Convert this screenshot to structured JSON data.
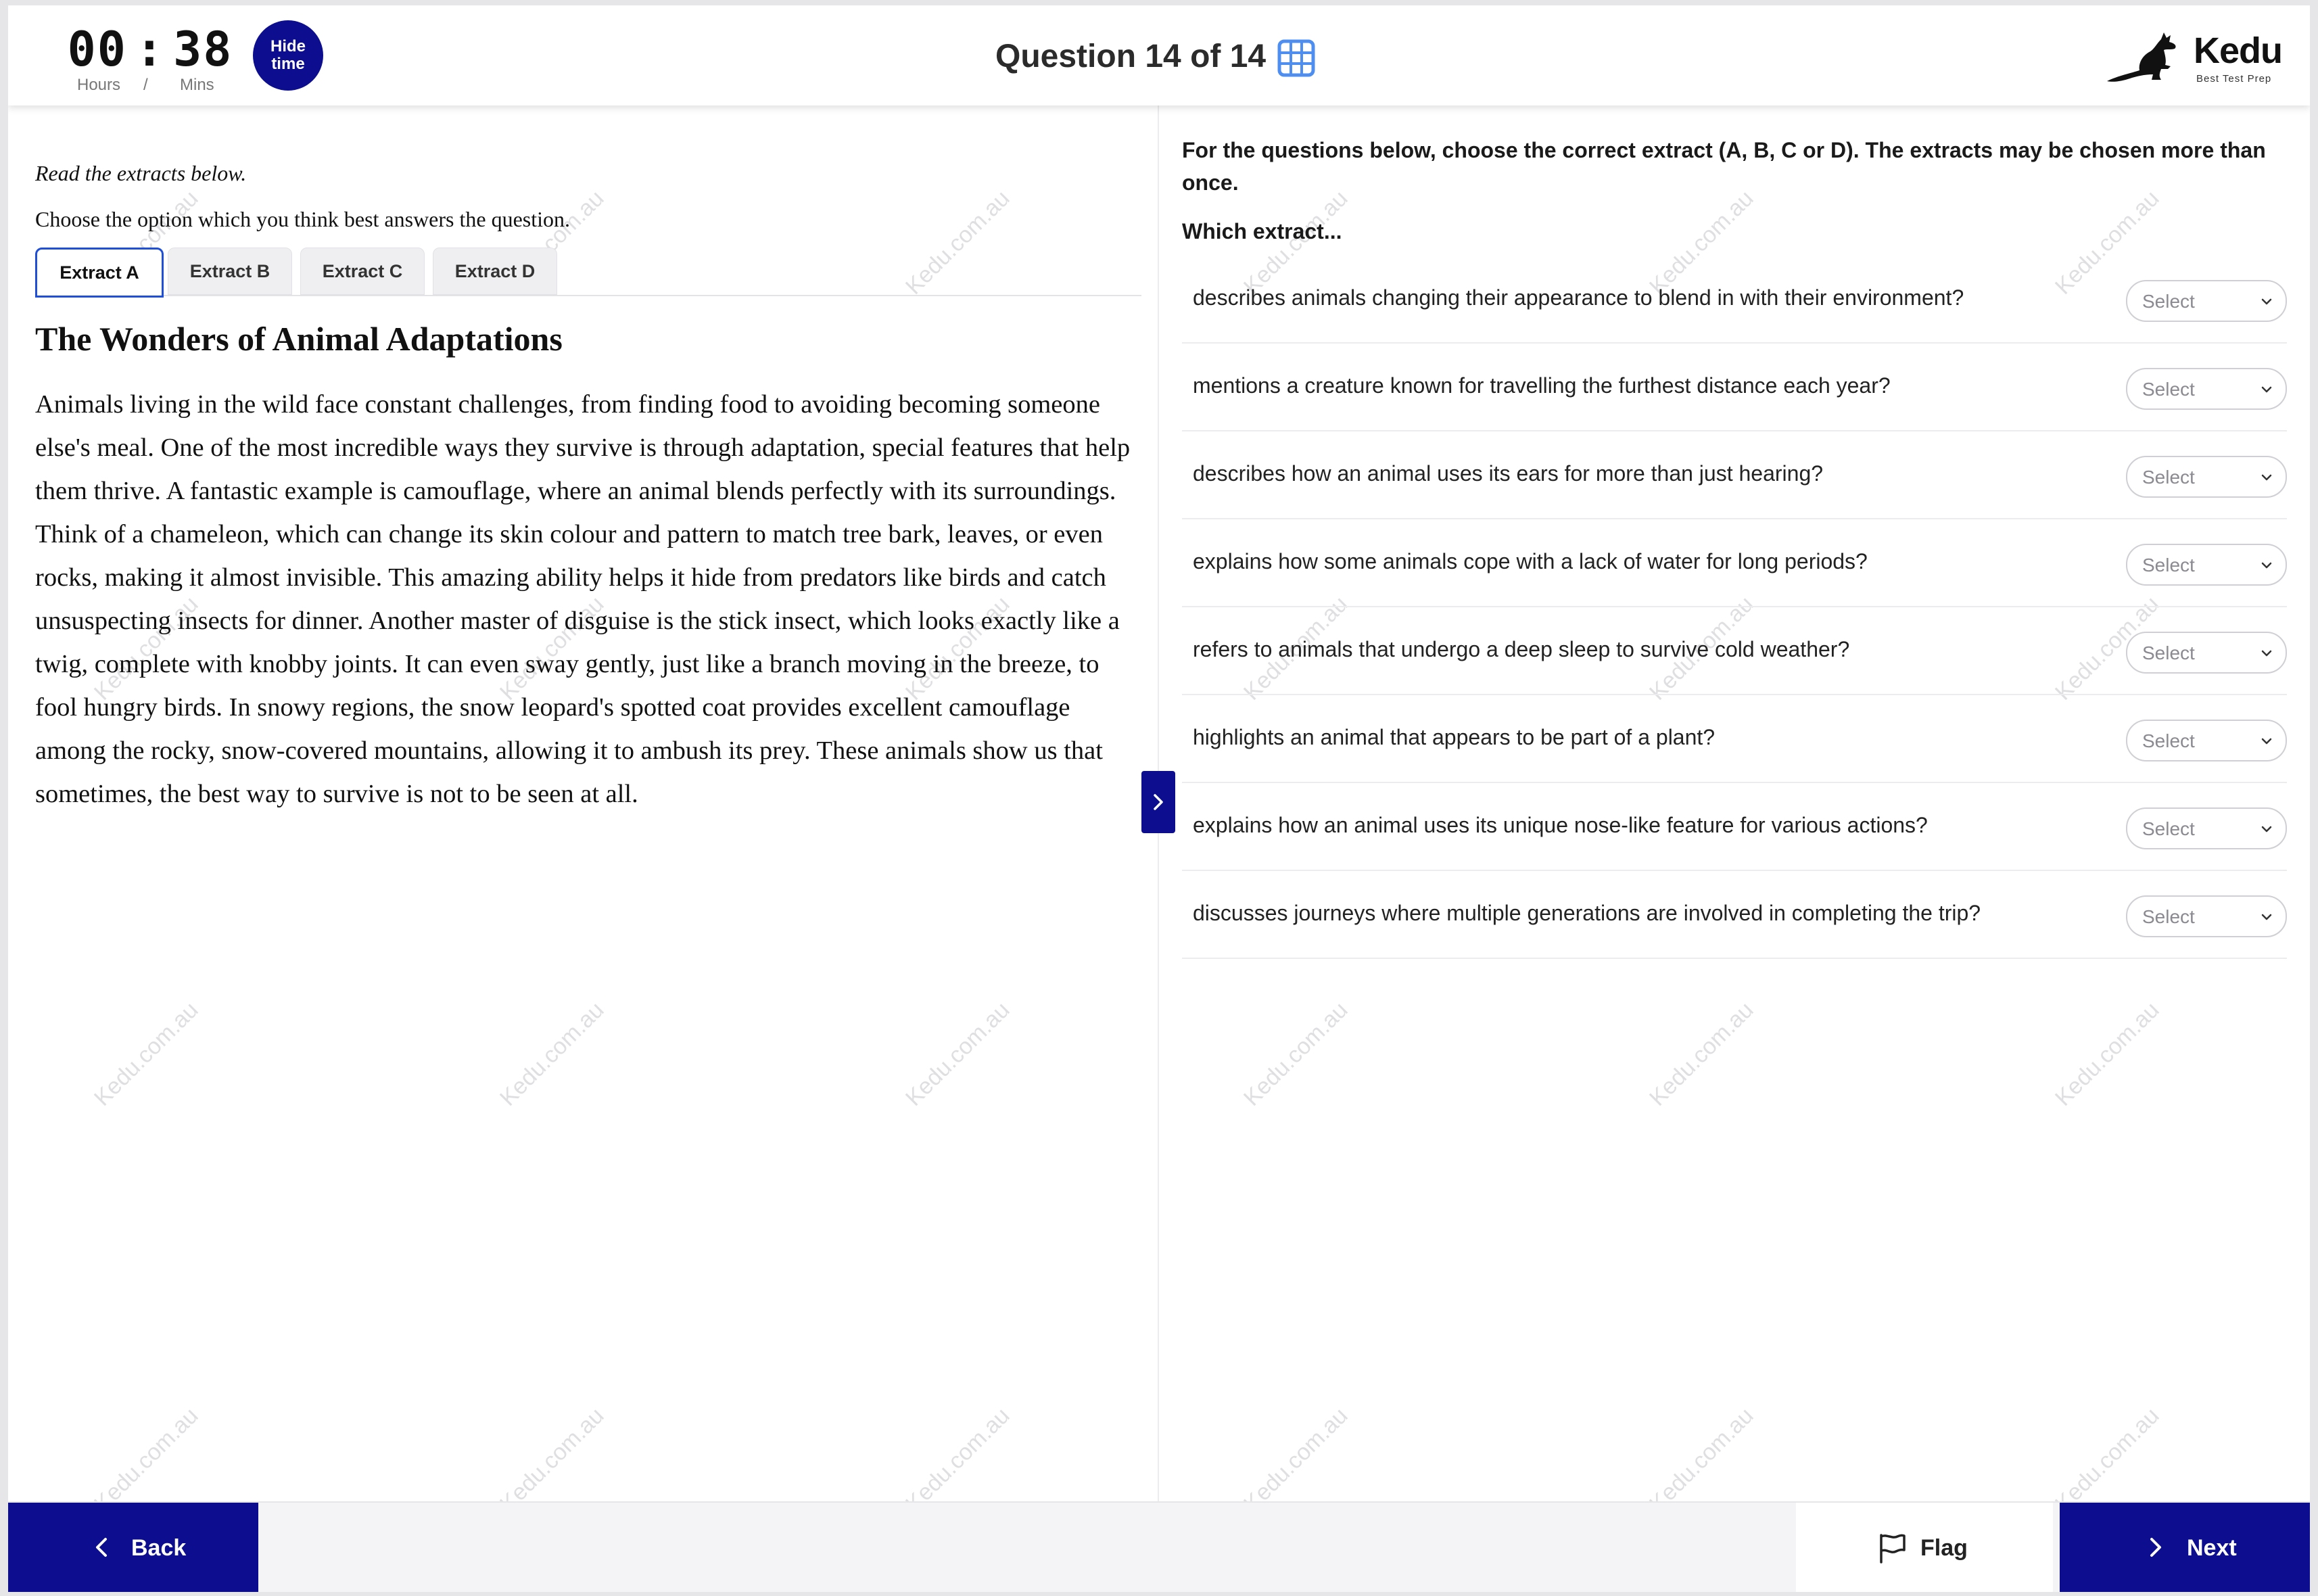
{
  "header": {
    "timer_hours": "00",
    "timer_separator": ":",
    "timer_minutes": "38",
    "hours_label": "Hours",
    "unit_separator": "/",
    "mins_label": "Mins",
    "hide_time_label": "Hide time",
    "question_counter": "Question 14 of 14",
    "grid_icon": "grid-icon",
    "brand_name": "Kedu",
    "brand_tagline": "Best Test Prep",
    "accent_color": "#0c0e8f"
  },
  "watermark_text": "Kedu.com.au",
  "left": {
    "intro_line1": "Read the extracts below.",
    "intro_line2": "Choose the option which you think best answers the question.",
    "tabs": [
      {
        "label": "Extract A",
        "active": true
      },
      {
        "label": "Extract B",
        "active": false
      },
      {
        "label": "Extract C",
        "active": false
      },
      {
        "label": "Extract D",
        "active": false
      }
    ],
    "passage_title": "The Wonders of Animal Adaptations",
    "passage_text": "Animals living in the wild face constant challenges, from finding food to avoiding becoming someone else's meal. One of the most incredible ways they survive is through adaptation, special features that help them thrive. A fantastic example is camouflage, where an animal blends perfectly with its surroundings. Think of a chameleon, which can change its skin colour and pattern to match tree bark, leaves, or even rocks, making it almost invisible. This amazing ability helps it hide from predators like birds and catch unsuspecting insects for dinner. Another master of disguise is the stick insect, which looks exactly like a twig, complete with knobby joints. It can even sway gently, just like a branch moving in the breeze, to fool hungry birds. In snowy regions, the snow leopard's spotted coat provides excellent camouflage among the rocky, snow-covered mountains, allowing it to ambush its prey. These animals show us that sometimes, the best way to survive is not to be seen at all."
  },
  "right": {
    "instructions": "For the questions below, choose the correct extract (A, B, C or D). The extracts may be chosen more than once.",
    "which_extract": "Which extract...",
    "questions": [
      {
        "text": "describes animals changing their appearance to blend in with their environment?",
        "selected": "Select"
      },
      {
        "text": "mentions a creature known for travelling the furthest distance each year?",
        "selected": "Select"
      },
      {
        "text": "describes how an animal uses its ears for more than just hearing?",
        "selected": "Select"
      },
      {
        "text": "explains how some animals cope with a lack of water for long periods?",
        "selected": "Select"
      },
      {
        "text": "refers to animals that undergo a deep sleep to survive cold weather?",
        "selected": "Select"
      },
      {
        "text": "highlights an animal that appears to be part of a plant?",
        "selected": "Select"
      },
      {
        "text": "explains how an animal uses its unique nose-like feature for various actions?",
        "selected": "Select"
      },
      {
        "text": "discusses journeys where multiple generations are involved in completing the trip?",
        "selected": "Select"
      }
    ]
  },
  "footer": {
    "back_label": "Back",
    "flag_label": "Flag",
    "next_label": "Next"
  }
}
